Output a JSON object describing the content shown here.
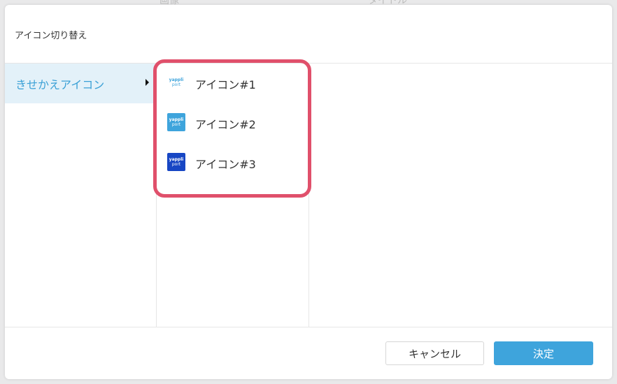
{
  "background": {
    "header_col1": "画像",
    "header_col2": "タイトル"
  },
  "dialog": {
    "title": "アイコン切り替え",
    "category": {
      "label": "きせかえアイコン",
      "selected": true,
      "arrow_icon": "triangle-right-icon"
    },
    "icon_options": [
      {
        "label": "アイコン#1",
        "thumb_line1": "yappli",
        "thumb_line2": "port",
        "thumb_bg": "#ffffff",
        "thumb_fg": "#3ea4dc"
      },
      {
        "label": "アイコン#2",
        "thumb_line1": "yappli",
        "thumb_line2": "port",
        "thumb_bg": "#3ea4dc",
        "thumb_fg": "#ffffff"
      },
      {
        "label": "アイコン#3",
        "thumb_line1": "yappli",
        "thumb_line2": "port",
        "thumb_bg": "#1746c4",
        "thumb_fg": "#ffffff"
      }
    ],
    "highlight_color": "#e0506b",
    "footer": {
      "cancel_label": "キャンセル",
      "ok_label": "決定"
    }
  },
  "colors": {
    "accent": "#3ea4dc",
    "selected_bg": "#e3f1f9"
  }
}
